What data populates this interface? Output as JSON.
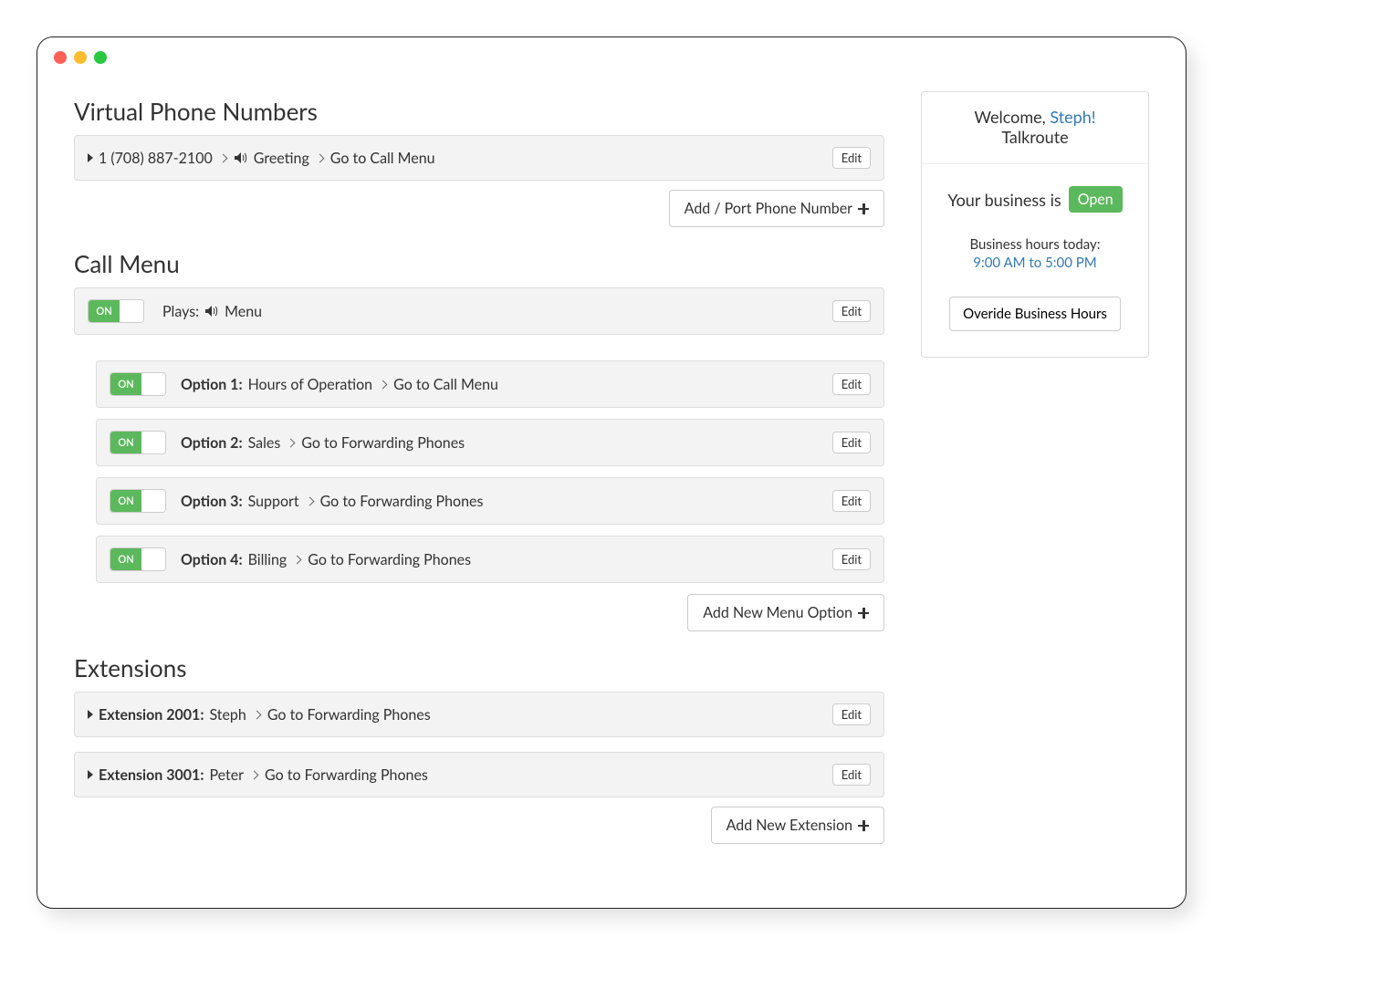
{
  "sections": {
    "virtual_numbers": {
      "title": "Virtual Phone Numbers",
      "row": {
        "number": "1 (708) 887-2100",
        "greeting": "Greeting",
        "dest": "Go to Call Menu",
        "edit": "Edit"
      },
      "add_button": "Add / Port Phone Number"
    },
    "call_menu": {
      "title": "Call Menu",
      "main": {
        "toggle": "ON",
        "plays_label": "Plays:",
        "menu_label": "Menu",
        "edit": "Edit"
      },
      "options": [
        {
          "toggle": "ON",
          "label": "Option 1:",
          "name": "Hours of Operation",
          "dest": "Go to Call Menu",
          "edit": "Edit"
        },
        {
          "toggle": "ON",
          "label": "Option 2:",
          "name": "Sales",
          "dest": "Go to Forwarding Phones",
          "edit": "Edit"
        },
        {
          "toggle": "ON",
          "label": "Option 3:",
          "name": "Support",
          "dest": "Go to Forwarding Phones",
          "edit": "Edit"
        },
        {
          "toggle": "ON",
          "label": "Option 4:",
          "name": "Billing",
          "dest": "Go to Forwarding Phones",
          "edit": "Edit"
        }
      ],
      "add_button": "Add New Menu Option"
    },
    "extensions": {
      "title": "Extensions",
      "rows": [
        {
          "label": "Extension 2001:",
          "name": "Steph",
          "dest": "Go to Forwarding Phones",
          "edit": "Edit"
        },
        {
          "label": "Extension 3001:",
          "name": "Peter",
          "dest": "Go to Forwarding Phones",
          "edit": "Edit"
        }
      ],
      "add_button": "Add New Extension"
    }
  },
  "sidebar": {
    "welcome_prefix": "Welcome, ",
    "user": "Steph!",
    "company": "Talkroute",
    "biz_prefix": "Your business is",
    "biz_status": "Open",
    "hours_label": "Business hours today:",
    "hours_value": "9:00 AM to 5:00 PM",
    "override": "Overide Business Hours"
  }
}
